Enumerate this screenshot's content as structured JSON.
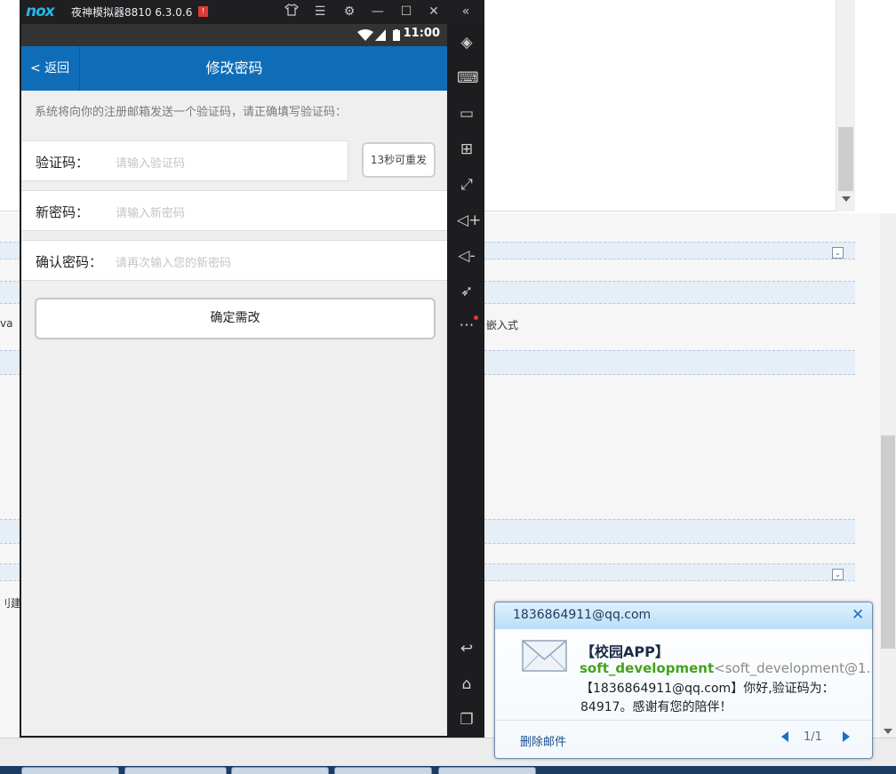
{
  "emulator": {
    "logo": "nox",
    "title": "夜神模拟器8810 6.3.0.6",
    "badge": "!",
    "title_icons": [
      "shirt-icon",
      "menu-icon",
      "gear-icon",
      "minimize-icon",
      "maximize-icon",
      "close-icon",
      "collapse-left-icon"
    ],
    "sidebar_icons": [
      "rotate-icon",
      "keyboard-icon",
      "screen-icon",
      "apk-install-icon",
      "fullscreen-icon",
      "volume-up-icon",
      "volume-down-icon",
      "rocket-icon",
      "more-icon",
      "back-icon",
      "home-icon",
      "recents-icon"
    ]
  },
  "phone": {
    "status_time": "11:00",
    "nav": {
      "back_label": "< 返回",
      "title": "修改密码"
    },
    "hint": "系统将向你的注册邮箱发送一个验证码，请正确填写验证码：",
    "fields": {
      "code_label": "验证码：",
      "code_placeholder": "请输入验证码",
      "new_label": "新密码：",
      "new_placeholder": "请输入新密码",
      "confirm_label": "确认密码：",
      "confirm_placeholder": "请再次输入您的新密码"
    },
    "resend_label": "13秒可重发",
    "submit_label": "确定需改"
  },
  "background": {
    "text_left_1": "va",
    "text_right_1": "嵌入式",
    "text_left_2": "刂建E"
  },
  "notification": {
    "account": "1836864911@qq.com",
    "subject": "【校园APP】",
    "sender_name": "soft_development",
    "sender_addr": "<soft_development@1...",
    "body": "【1836864911@qq.com】你好,验证码为：84917。感谢有您的陪伴！",
    "delete_label": "删除邮件",
    "pager": "1/1"
  },
  "colors": {
    "nav_blue": "#0f6db8",
    "sender_green": "#45a11e",
    "nox_cyan": "#23b7e5"
  }
}
